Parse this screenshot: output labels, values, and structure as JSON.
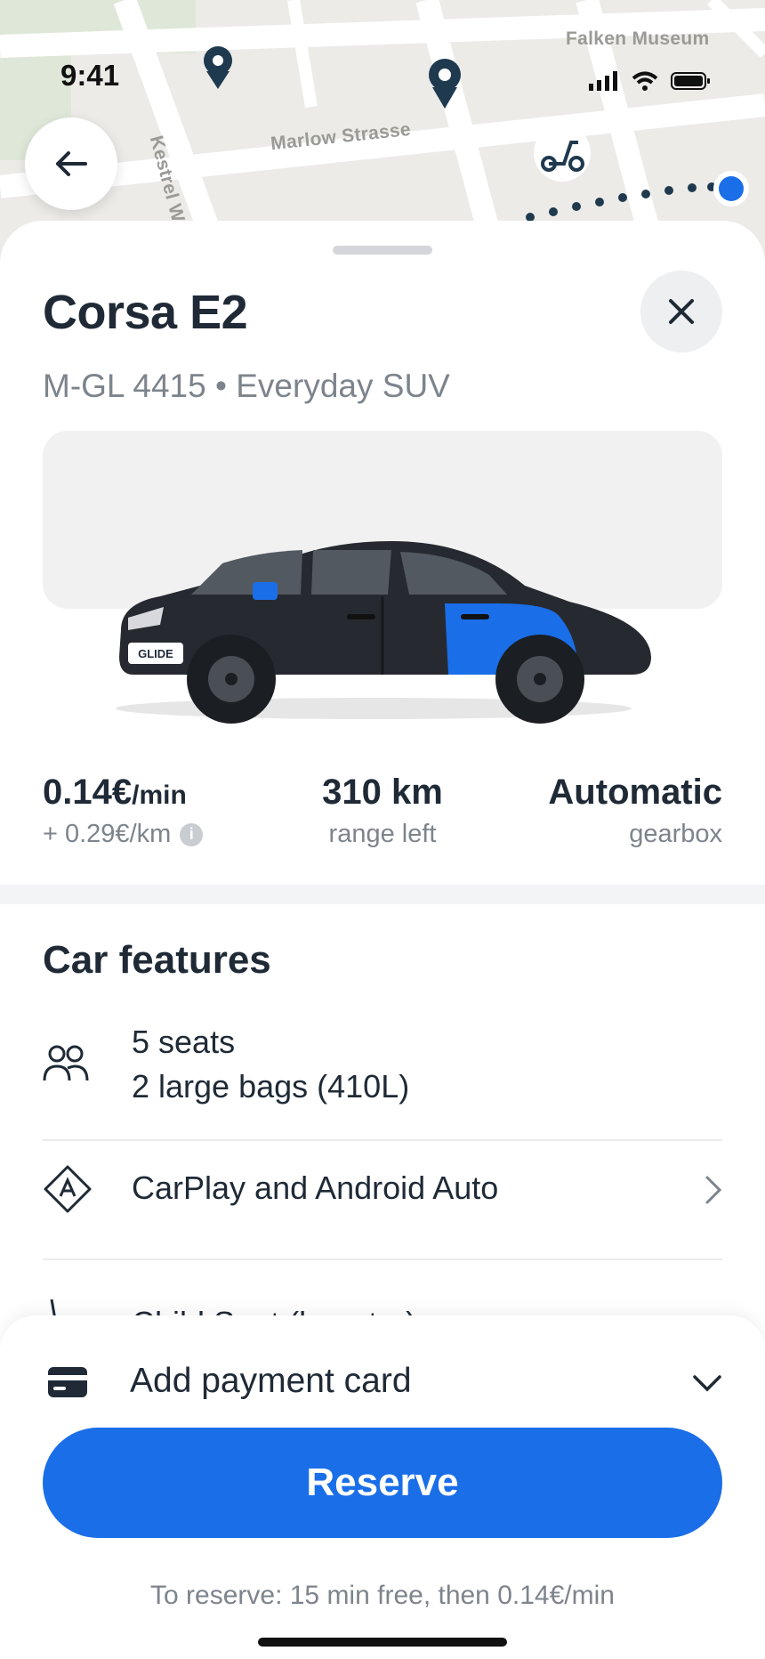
{
  "status_bar": {
    "time": "9:41"
  },
  "map": {
    "street_labels": [
      "Marlow Strasse",
      "Kestrel Weg",
      "Falken Museum"
    ]
  },
  "vehicle": {
    "name": "Corsa E2",
    "plate": "M-GL 4415",
    "separator": "•",
    "category": "Everyday SUV",
    "badge_text": "GLIDE",
    "brand_color": "#1a6ee8"
  },
  "stats": {
    "price_per_min": "0.14€",
    "price_unit": "/min",
    "price_per_km": "+ 0.29€/km",
    "range_value": "310 km",
    "range_label": "range left",
    "gearbox_value": "Automatic",
    "gearbox_label": "gearbox"
  },
  "features": {
    "title": "Car features",
    "items": [
      {
        "icon": "people-icon",
        "line1": "5 seats",
        "line2": "2 large bags (410L)"
      },
      {
        "icon": "carplay-icon",
        "line1": "CarPlay and Android Auto"
      },
      {
        "icon": "child-seat-icon",
        "line1": "Child Seat (booster)"
      }
    ]
  },
  "footer": {
    "payment_label": "Add payment card",
    "reserve_label": "Reserve",
    "note": "To reserve: 15 min free, then 0.14€/min"
  }
}
